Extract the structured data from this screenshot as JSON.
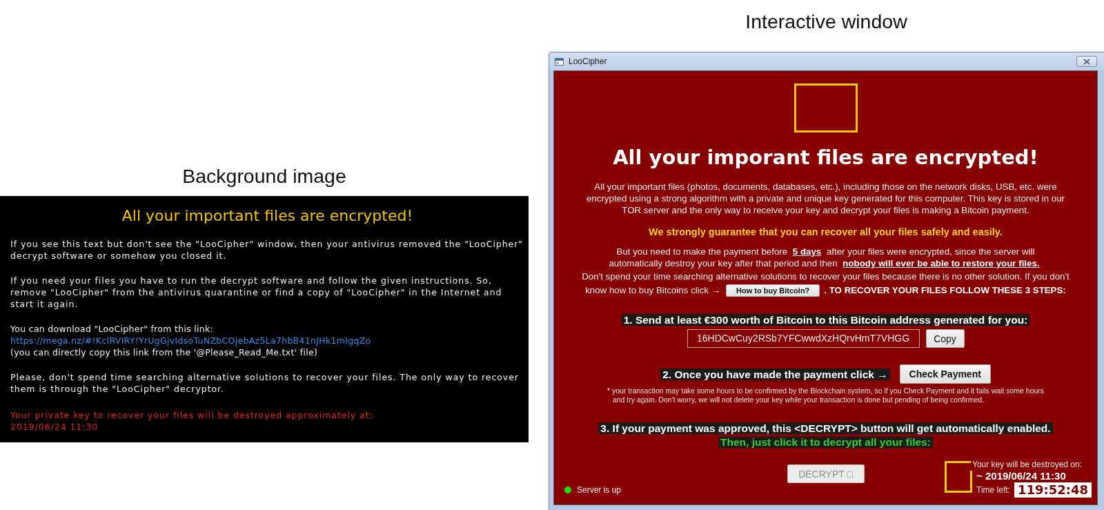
{
  "background_image": {
    "caption": "Background image",
    "heading": "All your important files are encrypted!",
    "paragraphs": [
      {
        "kind": "plain",
        "lines": [
          "If you see this text but don't see the \"LooCipher\" window, then your antivirus removed the \"LooCipher\"",
          "decrypt software or somehow you closed it."
        ]
      },
      {
        "kind": "plain",
        "lines": [
          "If you need your files you have to run the decrypt software and follow the given instructions. So,",
          "remove \"LooCipher\" from the antivirus quarantine or find a copy of \"LooCipher\" in the Internet and",
          "start it again."
        ]
      },
      {
        "kind": "download",
        "intro": "You can download \"LooCipher\" from this link:",
        "link": "https://mega.nz/#!KcIRVIRY!YrUgGjvIdsoTuNZbCOjebAz5La7hbB41nJHk1mIgqZo",
        "note": "(you can directly copy this link from the '@Please_Read_Me.txt' file)"
      },
      {
        "kind": "plain",
        "lines": [
          "Please, don't spend time searching alternative solutions to recover your files. The only way to recover",
          "them is through the \"LooCipher\" decryptor."
        ]
      },
      {
        "kind": "warning",
        "lines": [
          "Your private key to recover your files will be destroyed approximately at:",
          "2019/06/24 11:30"
        ]
      }
    ]
  },
  "interactive_window": {
    "caption": "Interactive window",
    "title": "LooCipher",
    "heading": "All your imporant files are encrypted!",
    "intro": [
      "All your important files (photos, documents, databases, etc.), including those on the network disks, USB, etc. were",
      "encrypted using a strong algorithm with a private and unique key generated for this computer. This key is stored in our",
      "TOR server and the only way to receive your key and decrypt your files is making a Bitcoin payment."
    ],
    "guarantee": "We strongly guarantee that you can recover all your files safely and easily.",
    "deadline": [
      "But you need to make the payment before **5 days** after your files were encrypted, since the server will",
      "automatically destroy your key after that period and then **nobody will ever be able to restore your files.**"
    ],
    "advice": {
      "lines": [
        "Don't spend your time searching alternative solutions to recover your files because there is no other solution. If you don't",
        "know how to buy Bitcoins click →"
      ],
      "button": "How to buy Bitcoin?",
      "after": ". TO RECOVER YOUR FILES FOLLOW THESE 3 STEPS:"
    },
    "steps": [
      {
        "kind": "address",
        "label": "1. Send at least €300 worth of Bitcoin to this Bitcoin address generated for you:",
        "address": "16HDCwCuy2RSb7YFCwwdXzHQrvHmT7VHGG",
        "button": "Copy"
      },
      {
        "kind": "check",
        "label": "2. Once you have made the payment click →",
        "button": "Check Payment",
        "note": [
          "* your transaction may take some hours to be confirmed by the Blockchain system, so if you Check Payment and it fails wait some hours",
          "and try again. Don't worry, we will not delete your key while your transaction is done but pending of being confirmed."
        ]
      },
      {
        "kind": "decrypt",
        "label": "3. If your payment was approved, this <DECRYPT> button will get automatically enabled.",
        "hint": "Then, just click it to decrypt all your files:"
      }
    ],
    "decrypt_button": {
      "label": "DECRYPT □",
      "disabled": true
    },
    "server_status": {
      "text": "Server is up",
      "online": true
    },
    "countdown": {
      "label": "Your key will be destroyed on:",
      "date": "~ 2019/06/24 11:30",
      "time_label": "Time left:",
      "time_left": "119:52:48"
    }
  }
}
